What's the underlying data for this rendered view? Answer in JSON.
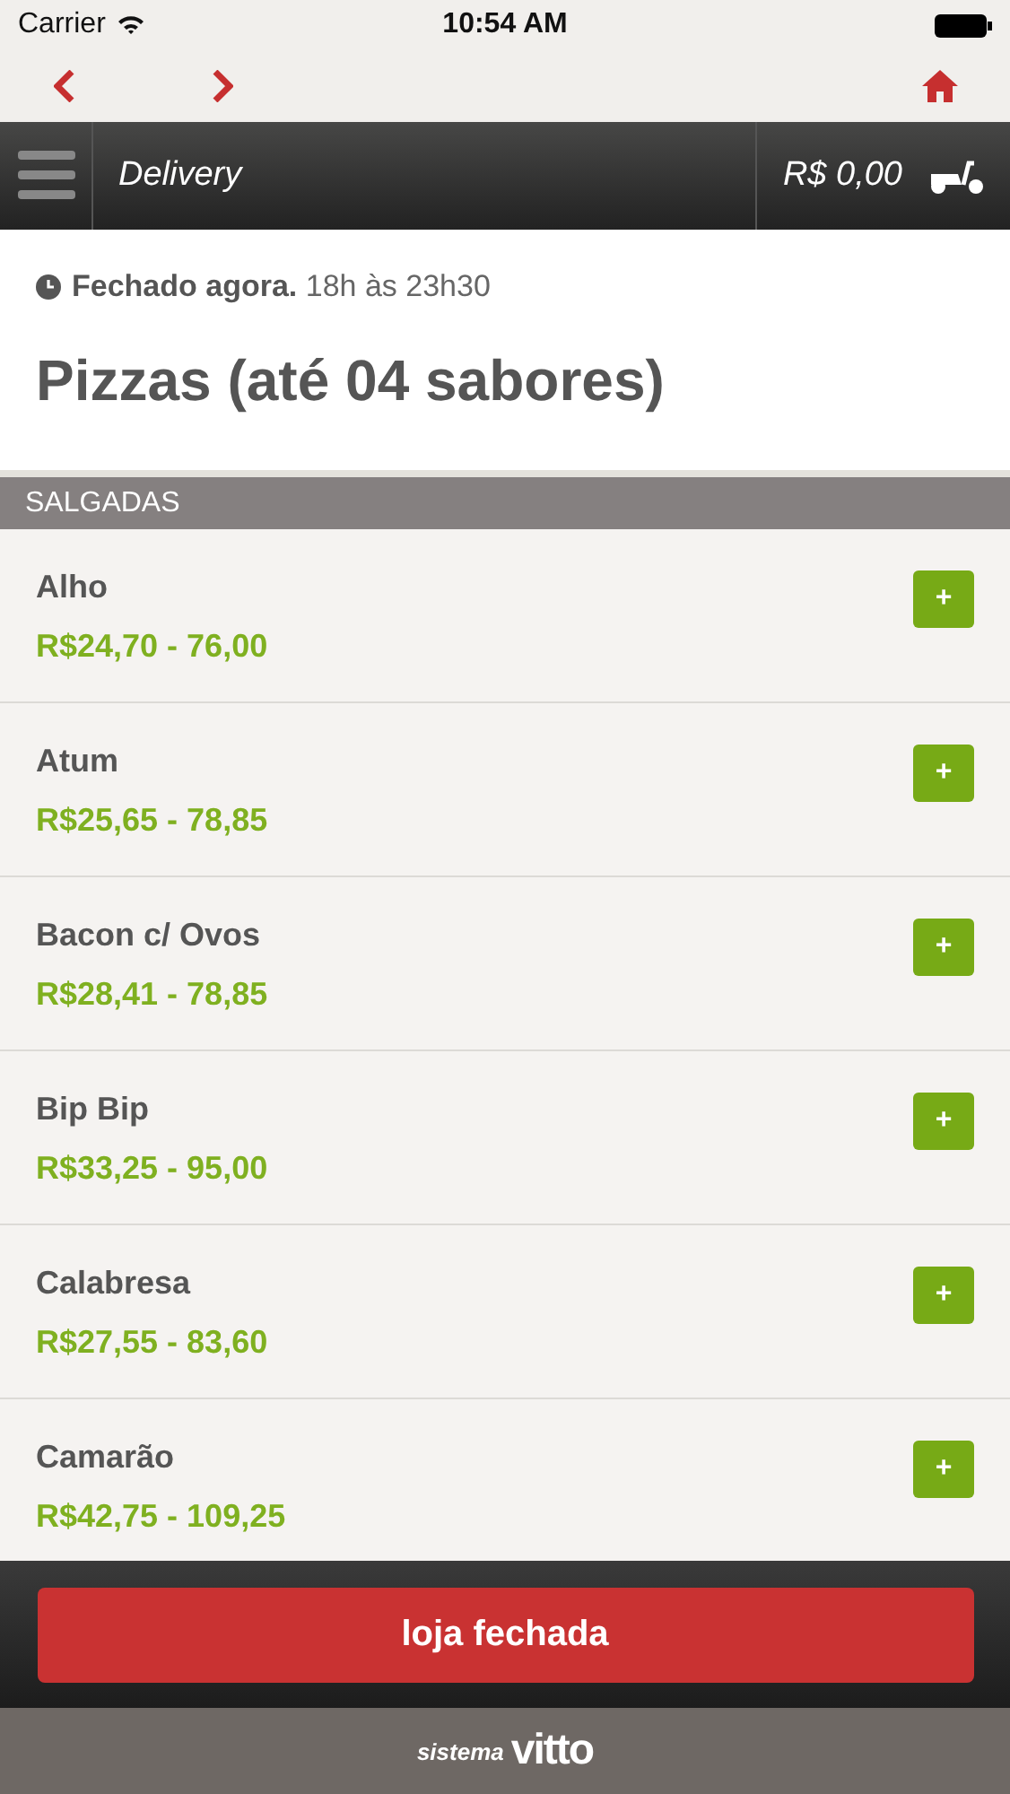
{
  "status_bar": {
    "carrier": "Carrier",
    "time": "10:54 AM"
  },
  "header": {
    "title": "Delivery",
    "cart_total": "R$ 0,00"
  },
  "store_status": {
    "state": "Fechado agora.",
    "hours": "18h às 23h30"
  },
  "page_title": "Pizzas (até 04 sabores)",
  "category": "SALGADAS",
  "items": [
    {
      "name": "Alho",
      "price": "R$24,70 - 76,00",
      "add": "+"
    },
    {
      "name": "Atum",
      "price": "R$25,65 - 78,85",
      "add": "+"
    },
    {
      "name": "Bacon c/ Ovos",
      "price": "R$28,41 - 78,85",
      "add": "+"
    },
    {
      "name": "Bip Bip",
      "price": "R$33,25 - 95,00",
      "add": "+"
    },
    {
      "name": "Calabresa",
      "price": "R$27,55 - 83,60",
      "add": "+"
    },
    {
      "name": "Camarão",
      "price": "R$42,75 - 109,25",
      "add": "+"
    }
  ],
  "footer": {
    "button": "loja fechada",
    "brand_prefix": "sistema",
    "brand_name": "vitto"
  }
}
